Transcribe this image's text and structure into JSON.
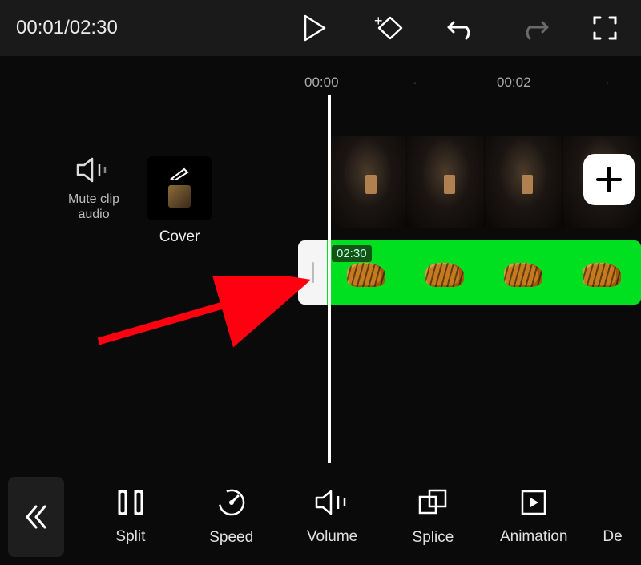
{
  "time": {
    "current": "00:01",
    "total": "02:30"
  },
  "ruler": {
    "t0": "00:00",
    "t1": "00:02"
  },
  "leftTools": {
    "muteLabel": "Mute clip\naudio",
    "coverLabel": "Cover"
  },
  "overlay": {
    "duration": "02:30"
  },
  "bottomTools": {
    "split": "Split",
    "speed": "Speed",
    "volume": "Volume",
    "splice": "Splice",
    "animation": "Animation",
    "delete": "De"
  }
}
